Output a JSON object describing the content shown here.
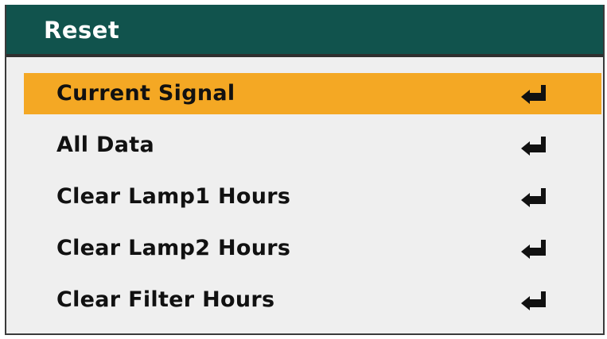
{
  "title": "Reset",
  "items": [
    {
      "label": "Current Signal",
      "selected": true
    },
    {
      "label": "All Data",
      "selected": false
    },
    {
      "label": "Clear Lamp1 Hours",
      "selected": false
    },
    {
      "label": "Clear Lamp2 Hours",
      "selected": false
    },
    {
      "label": "Clear Filter Hours",
      "selected": false
    }
  ],
  "icons": {
    "enter": "enter-return-icon"
  },
  "colors": {
    "title_bar": "#11534d",
    "selection": "#f4a824",
    "menu_background": "#efefef"
  }
}
